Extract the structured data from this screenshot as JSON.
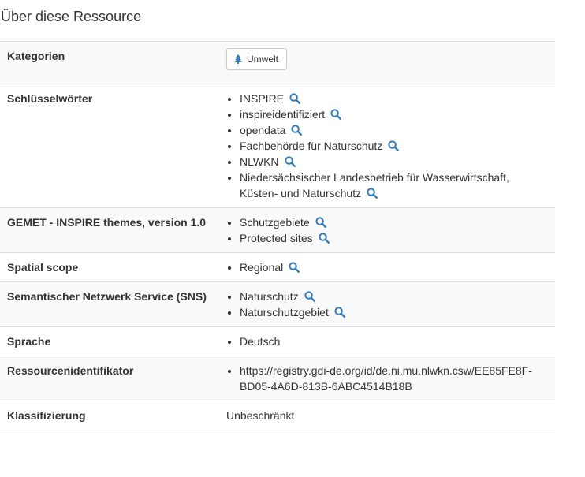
{
  "heading": "Über diese Ressource",
  "colors": {
    "icon_blue": "#337ab7",
    "row_stripe": "#f9f9f9",
    "border": "#dddddd"
  },
  "rows": {
    "kategorien": {
      "label": "Kategorien",
      "button_label": "Umwelt",
      "button_icon": "tree-icon"
    },
    "schluesselwoerter": {
      "label": "Schlüsselwörter",
      "items": [
        "INSPIRE",
        "inspireidentifiziert",
        "opendata",
        "Fachbehörde für Naturschutz",
        "NLWKN",
        "Niedersächsischer Landesbetrieb für Wasserwirtschaft, Küsten- und Naturschutz"
      ]
    },
    "gemet": {
      "label": "GEMET - INSPIRE themes, version 1.0",
      "items": [
        "Schutzgebiete",
        "Protected sites"
      ]
    },
    "spatial_scope": {
      "label": "Spatial scope",
      "items": [
        "Regional"
      ]
    },
    "sns": {
      "label": "Semantischer Netzwerk Service (SNS)",
      "items": [
        "Naturschutz",
        "Naturschutzgebiet"
      ]
    },
    "sprache": {
      "label": "Sprache",
      "items": [
        "Deutsch"
      ]
    },
    "ressourcenidentifikator": {
      "label": "Ressourcenidentifikator",
      "items": [
        "https://registry.gdi-de.org/id/de.ni.mu.nlwkn.csw/EE85FE8F-BD05-4A6D-813B-6ABC4514B18B"
      ]
    },
    "klassifizierung": {
      "label": "Klassifizierung",
      "value": "Unbeschränkt"
    }
  }
}
